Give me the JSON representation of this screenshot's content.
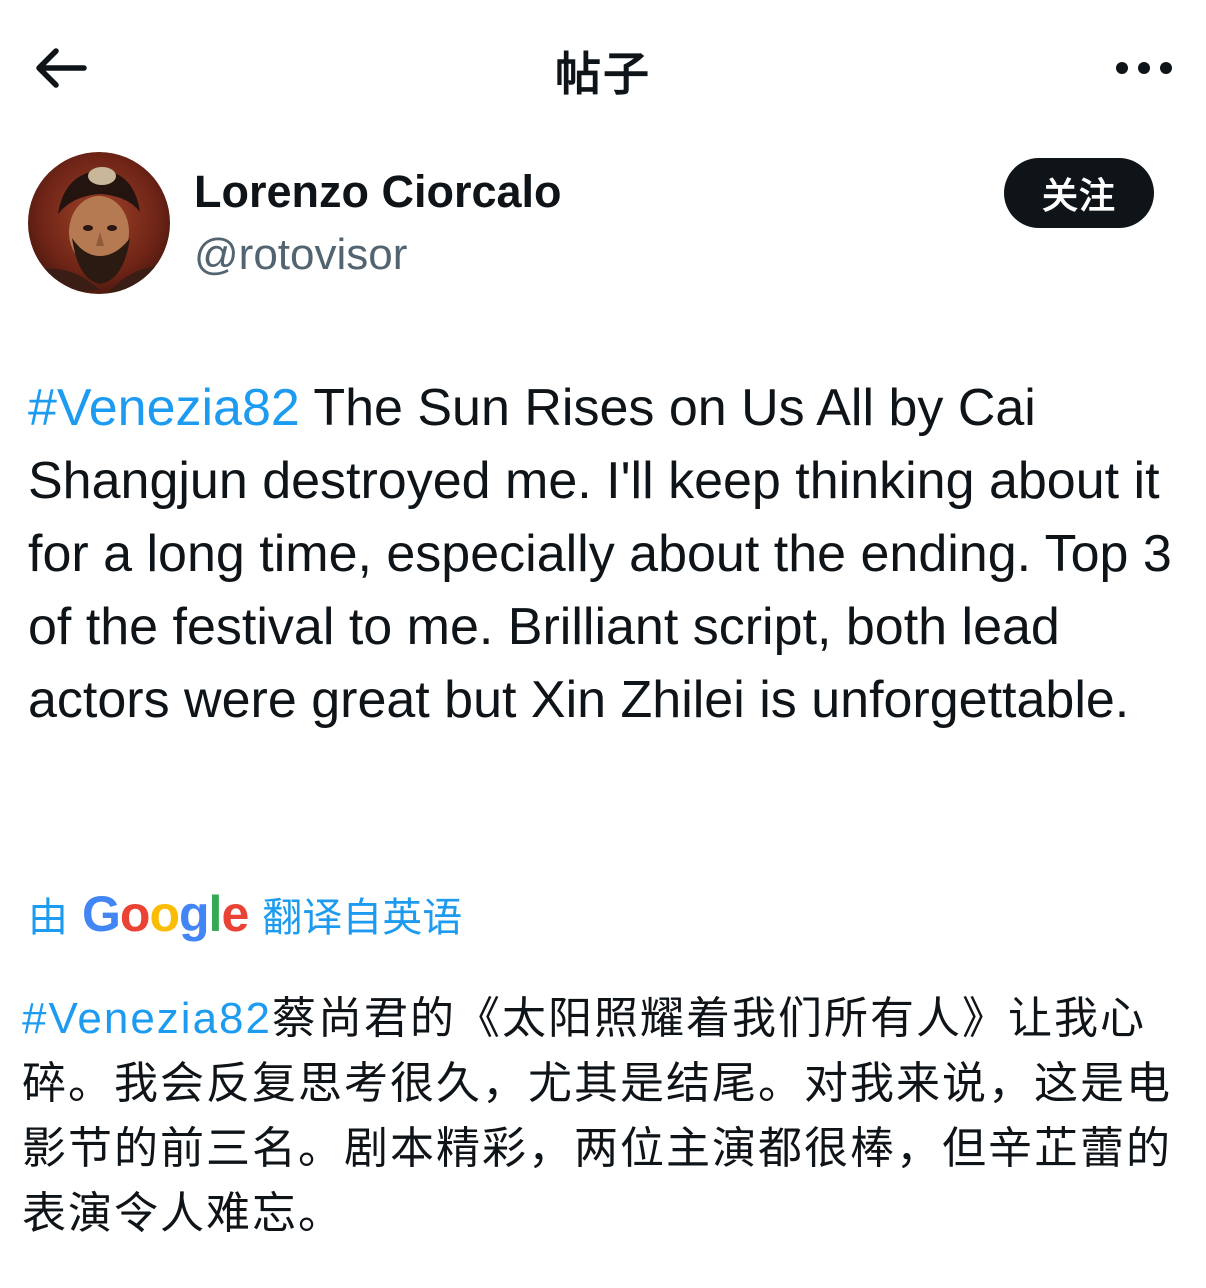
{
  "header": {
    "title": "帖子",
    "back_icon": "arrow-left-icon",
    "more_icon": "more-horizontal-icon"
  },
  "author": {
    "name": "Lorenzo Ciorcalo",
    "handle": "@rotovisor",
    "follow_label": "关注",
    "avatar_icon": "avatar-portrait"
  },
  "post": {
    "hashtag": "#Venezia82",
    "text": " The Sun Rises on Us All by Cai Shangjun destroyed me. I'll keep thinking about it for a long time, especially about the ending. Top 3 of the festival to me. Brilliant script, both lead actors were great but Xin Zhilei is unforgettable."
  },
  "translation": {
    "prefix": "由",
    "brand_letters": [
      "G",
      "o",
      "o",
      "g",
      "l",
      "e"
    ],
    "brand_colors": [
      "#4285F4",
      "#EA4335",
      "#FBBC05",
      "#4285F4",
      "#34A853",
      "#EA4335"
    ],
    "suffix": "翻译自英语",
    "hashtag": "#Venezia82",
    "text": "蔡尚君的《太阳照耀着我们所有人》让我心碎。我会反复思考很久，尤其是结尾。对我来说，这是电影节的前三名。剧本精彩，两位主演都很棒，但辛芷蕾的表演令人难忘。"
  },
  "colors": {
    "accent": "#1d9bf0",
    "text": "#0f1419",
    "secondary": "#536471",
    "button_bg": "#0f1419"
  }
}
